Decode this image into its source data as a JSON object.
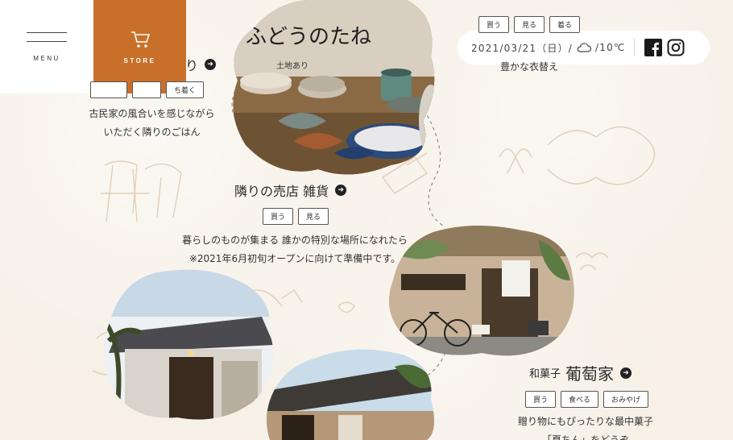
{
  "header": {
    "menu_label": "MENU",
    "store_label": "STORE",
    "date": "2021/03/21（日）/",
    "temperature": "/10℃",
    "weather_icon": "cloud-icon",
    "sns": [
      "facebook-icon",
      "instagram-icon"
    ]
  },
  "colors": {
    "store_bg": "#c8702a",
    "paper": "#f6f0e6",
    "pill": "#ffffff"
  },
  "shops": {
    "top_left": {
      "title_fragment": "り",
      "tags": [
        "",
        "",
        "ち着く"
      ],
      "desc": [
        "古民家の風合いを感じながら",
        "いただく隣りのごはん"
      ]
    },
    "top_right": {
      "tags": [
        "買う",
        "見る",
        "着る"
      ],
      "desc": [
        "豊かな衣替え"
      ]
    },
    "zakka": {
      "sign": "ふどうのたね",
      "sign_sub": "土地あり",
      "title": "隣りの売店 雑貨",
      "tags": [
        "買う",
        "見る"
      ],
      "desc": [
        "暮らしのものが集まる 誰かの特別な場所になれたら",
        "※2021年6月初旬オープンに向けて準備中です。"
      ]
    },
    "wagashi": {
      "title_prefix": "和菓子",
      "title": "葡萄家",
      "tags": [
        "買う",
        "食べる",
        "おみやげ"
      ],
      "desc": [
        "贈り物にもぴったりな最中菓子",
        "「夏ちん」をどうぞ"
      ]
    }
  }
}
